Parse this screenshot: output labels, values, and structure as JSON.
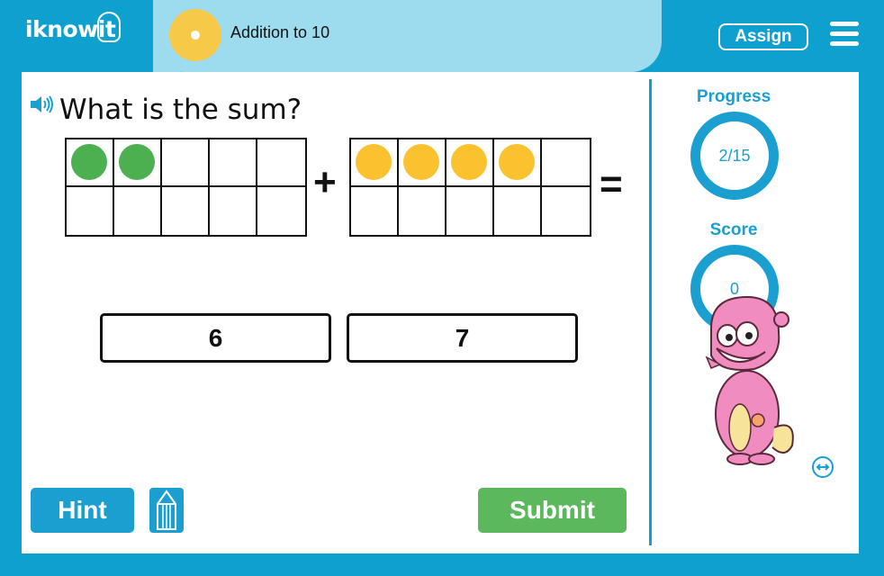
{
  "header": {
    "logo_text": "iknowit",
    "lesson_title": "Addition to 10",
    "assign_label": "Assign",
    "menu_icon": "hamburger-menu-icon",
    "lesson_icon": "disc-icon"
  },
  "question": {
    "speaker_icon": "speaker-icon",
    "text": "What is the sum?",
    "plus_symbol": "+",
    "equals_symbol": "=",
    "frames": [
      {
        "filled": 2,
        "color": "#4caf50",
        "total": 10
      },
      {
        "filled": 4,
        "color": "#f9c22e",
        "total": 10
      }
    ]
  },
  "answers": [
    {
      "label": "6"
    },
    {
      "label": "7"
    }
  ],
  "buttons": {
    "hint_label": "Hint",
    "pencil_icon": "pencil-icon",
    "submit_label": "Submit"
  },
  "side": {
    "progress_label": "Progress",
    "progress_value": "2/15",
    "score_label": "Score",
    "score_value": "0",
    "mascot": "pink-monster-mascot",
    "resize_icon": "resize-icon"
  },
  "colors": {
    "brand": "#0ea0cf",
    "title_bg": "#9ddcef",
    "submit": "#5cb85c",
    "green_dot": "#4caf50",
    "yellow_dot": "#f9c22e"
  }
}
